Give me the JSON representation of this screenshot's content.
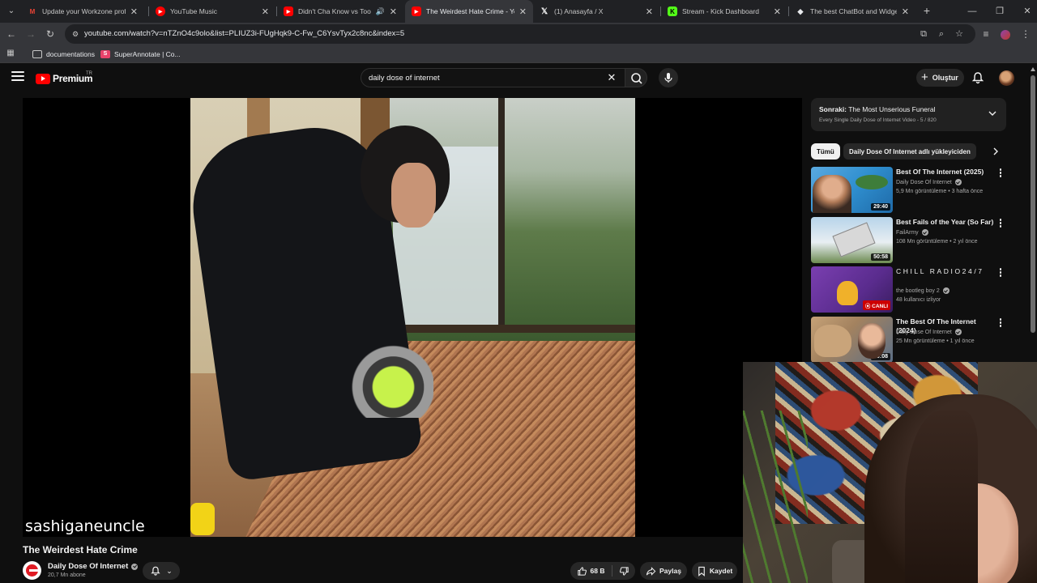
{
  "browser": {
    "tabs": [
      {
        "title": "Update your Workzone profile",
        "favicon": "gmail-icon",
        "color": "#ea4335"
      },
      {
        "title": "YouTube Music",
        "favicon": "youtube-music-icon",
        "color": "#ff0000"
      },
      {
        "title": "Didn't Cha Know vs Too De",
        "favicon": "youtube-icon",
        "color": "#ff0000",
        "audio": true
      },
      {
        "title": "The Weirdest Hate Crime - You",
        "favicon": "youtube-icon",
        "color": "#ff0000",
        "active": true
      },
      {
        "title": "(1) Anasayfa / X",
        "favicon": "x-icon",
        "color": "#ffffff"
      },
      {
        "title": "Stream - Kick Dashboard",
        "favicon": "kick-icon",
        "color": "#53fc18"
      },
      {
        "title": "The best ChatBot and Widgets",
        "favicon": "chatbot-icon",
        "color": "#e8eaed"
      }
    ],
    "url": "youtube.com/watch?v=nTZnO4c9olo&list=PLIUZ3i-FUgHqk9-C-Fw_C6YsvTyx2c8nc&index=5",
    "bookmarks": [
      {
        "label": "documentations",
        "icon": "folder-icon"
      },
      {
        "label": "SuperAnnotate | Co...",
        "icon": "superannotate-icon"
      }
    ]
  },
  "youtube": {
    "logo_text": "Premium",
    "country": "TR",
    "search_value": "daily dose of internet",
    "create_label": "Oluştur",
    "video": {
      "watermark": "sashiganeuncle",
      "title": "The Weirdest Hate Crime",
      "channel": "Daily Dose Of Internet",
      "subscribers": "20,7 Mn abone",
      "likes": "68 B",
      "share_label": "Paylaş",
      "save_label": "Kaydet"
    },
    "playlist": {
      "next_prefix": "Sonraki:",
      "next_title": "The Most Unserious Funeral",
      "subtitle": "Every Single Daily Dose of Internet Video - 5 / 820"
    },
    "chips": [
      "Tümü",
      "Daily Dose Of Internet adlı yükleyiciden"
    ],
    "recommendations": [
      {
        "title": "Best Of The Internet (2025)",
        "channel": "Daily Dose Of Internet",
        "verified": true,
        "meta": "5,9 Mn görüntüleme • 3 hafta önce",
        "duration": "29:40"
      },
      {
        "title": "Best Fails of the Year (So Far)",
        "channel": "FailArmy",
        "verified": true,
        "meta": "108 Mn görüntüleme • 2 yıl önce",
        "duration": "50:58"
      },
      {
        "title": "CHILL RADIO24/7",
        "channel": "the bootleg boy 2",
        "verified": true,
        "meta": "48 kullanıcı izliyor",
        "badge": "CANLI"
      },
      {
        "title": "The Best Of The Internet (2024)",
        "channel": "Daily Dose Of Internet",
        "verified": true,
        "meta": "25 Mn görüntüleme • 1 yıl önce",
        "duration": "29:08"
      }
    ]
  }
}
